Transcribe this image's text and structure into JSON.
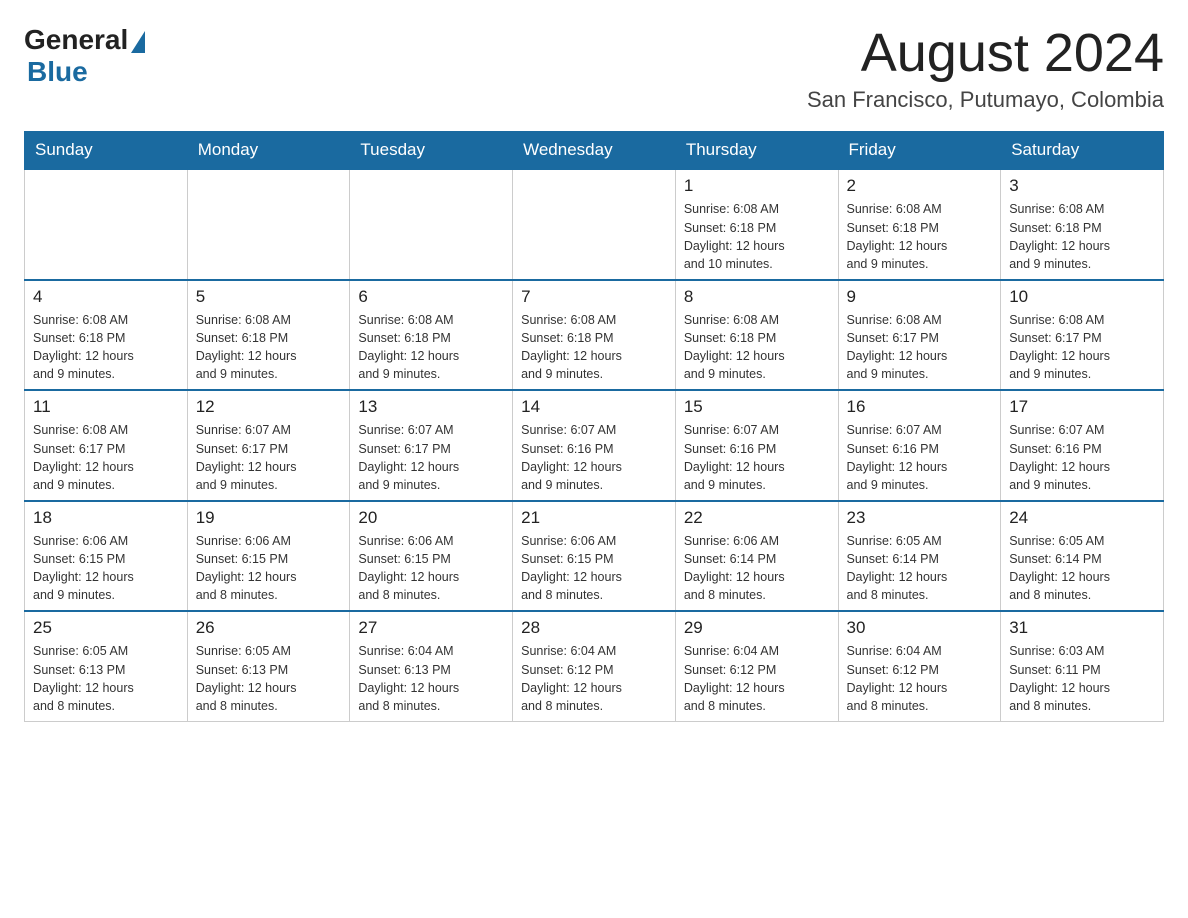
{
  "header": {
    "logo_general": "General",
    "logo_blue": "Blue",
    "title": "August 2024",
    "subtitle": "San Francisco, Putumayo, Colombia"
  },
  "weekdays": [
    "Sunday",
    "Monday",
    "Tuesday",
    "Wednesday",
    "Thursday",
    "Friday",
    "Saturday"
  ],
  "weeks": [
    [
      {
        "day": "",
        "info": ""
      },
      {
        "day": "",
        "info": ""
      },
      {
        "day": "",
        "info": ""
      },
      {
        "day": "",
        "info": ""
      },
      {
        "day": "1",
        "info": "Sunrise: 6:08 AM\nSunset: 6:18 PM\nDaylight: 12 hours\nand 10 minutes."
      },
      {
        "day": "2",
        "info": "Sunrise: 6:08 AM\nSunset: 6:18 PM\nDaylight: 12 hours\nand 9 minutes."
      },
      {
        "day": "3",
        "info": "Sunrise: 6:08 AM\nSunset: 6:18 PM\nDaylight: 12 hours\nand 9 minutes."
      }
    ],
    [
      {
        "day": "4",
        "info": "Sunrise: 6:08 AM\nSunset: 6:18 PM\nDaylight: 12 hours\nand 9 minutes."
      },
      {
        "day": "5",
        "info": "Sunrise: 6:08 AM\nSunset: 6:18 PM\nDaylight: 12 hours\nand 9 minutes."
      },
      {
        "day": "6",
        "info": "Sunrise: 6:08 AM\nSunset: 6:18 PM\nDaylight: 12 hours\nand 9 minutes."
      },
      {
        "day": "7",
        "info": "Sunrise: 6:08 AM\nSunset: 6:18 PM\nDaylight: 12 hours\nand 9 minutes."
      },
      {
        "day": "8",
        "info": "Sunrise: 6:08 AM\nSunset: 6:18 PM\nDaylight: 12 hours\nand 9 minutes."
      },
      {
        "day": "9",
        "info": "Sunrise: 6:08 AM\nSunset: 6:17 PM\nDaylight: 12 hours\nand 9 minutes."
      },
      {
        "day": "10",
        "info": "Sunrise: 6:08 AM\nSunset: 6:17 PM\nDaylight: 12 hours\nand 9 minutes."
      }
    ],
    [
      {
        "day": "11",
        "info": "Sunrise: 6:08 AM\nSunset: 6:17 PM\nDaylight: 12 hours\nand 9 minutes."
      },
      {
        "day": "12",
        "info": "Sunrise: 6:07 AM\nSunset: 6:17 PM\nDaylight: 12 hours\nand 9 minutes."
      },
      {
        "day": "13",
        "info": "Sunrise: 6:07 AM\nSunset: 6:17 PM\nDaylight: 12 hours\nand 9 minutes."
      },
      {
        "day": "14",
        "info": "Sunrise: 6:07 AM\nSunset: 6:16 PM\nDaylight: 12 hours\nand 9 minutes."
      },
      {
        "day": "15",
        "info": "Sunrise: 6:07 AM\nSunset: 6:16 PM\nDaylight: 12 hours\nand 9 minutes."
      },
      {
        "day": "16",
        "info": "Sunrise: 6:07 AM\nSunset: 6:16 PM\nDaylight: 12 hours\nand 9 minutes."
      },
      {
        "day": "17",
        "info": "Sunrise: 6:07 AM\nSunset: 6:16 PM\nDaylight: 12 hours\nand 9 minutes."
      }
    ],
    [
      {
        "day": "18",
        "info": "Sunrise: 6:06 AM\nSunset: 6:15 PM\nDaylight: 12 hours\nand 9 minutes."
      },
      {
        "day": "19",
        "info": "Sunrise: 6:06 AM\nSunset: 6:15 PM\nDaylight: 12 hours\nand 8 minutes."
      },
      {
        "day": "20",
        "info": "Sunrise: 6:06 AM\nSunset: 6:15 PM\nDaylight: 12 hours\nand 8 minutes."
      },
      {
        "day": "21",
        "info": "Sunrise: 6:06 AM\nSunset: 6:15 PM\nDaylight: 12 hours\nand 8 minutes."
      },
      {
        "day": "22",
        "info": "Sunrise: 6:06 AM\nSunset: 6:14 PM\nDaylight: 12 hours\nand 8 minutes."
      },
      {
        "day": "23",
        "info": "Sunrise: 6:05 AM\nSunset: 6:14 PM\nDaylight: 12 hours\nand 8 minutes."
      },
      {
        "day": "24",
        "info": "Sunrise: 6:05 AM\nSunset: 6:14 PM\nDaylight: 12 hours\nand 8 minutes."
      }
    ],
    [
      {
        "day": "25",
        "info": "Sunrise: 6:05 AM\nSunset: 6:13 PM\nDaylight: 12 hours\nand 8 minutes."
      },
      {
        "day": "26",
        "info": "Sunrise: 6:05 AM\nSunset: 6:13 PM\nDaylight: 12 hours\nand 8 minutes."
      },
      {
        "day": "27",
        "info": "Sunrise: 6:04 AM\nSunset: 6:13 PM\nDaylight: 12 hours\nand 8 minutes."
      },
      {
        "day": "28",
        "info": "Sunrise: 6:04 AM\nSunset: 6:12 PM\nDaylight: 12 hours\nand 8 minutes."
      },
      {
        "day": "29",
        "info": "Sunrise: 6:04 AM\nSunset: 6:12 PM\nDaylight: 12 hours\nand 8 minutes."
      },
      {
        "day": "30",
        "info": "Sunrise: 6:04 AM\nSunset: 6:12 PM\nDaylight: 12 hours\nand 8 minutes."
      },
      {
        "day": "31",
        "info": "Sunrise: 6:03 AM\nSunset: 6:11 PM\nDaylight: 12 hours\nand 8 minutes."
      }
    ]
  ]
}
